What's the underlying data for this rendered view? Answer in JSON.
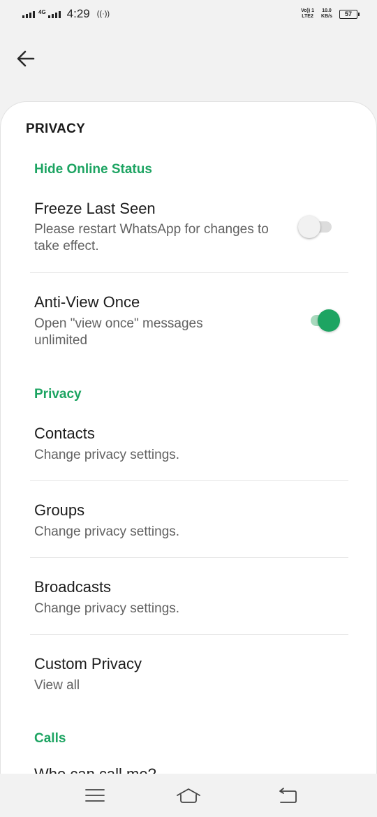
{
  "status_bar": {
    "network_small": "4G",
    "time": "4:29",
    "hotspot": "((·))",
    "volte": "Vo)) 1",
    "lte": "LTE2",
    "speed_value": "10.0",
    "speed_unit": "KB/s",
    "battery": "57"
  },
  "header": {
    "back_icon": "arrow-left-icon"
  },
  "page": {
    "title": "PRIVACY"
  },
  "sections": {
    "hide_online": {
      "header": "Hide Online Status",
      "freeze": {
        "title": "Freeze Last Seen",
        "subtitle": "Please restart WhatsApp for changes to take effect.",
        "enabled": false
      },
      "anti_view": {
        "title": "Anti-View Once",
        "subtitle": "Open \"view once\" messages unlimited",
        "enabled": true
      }
    },
    "privacy": {
      "header": "Privacy",
      "contacts": {
        "title": "Contacts",
        "subtitle": "Change privacy settings."
      },
      "groups": {
        "title": "Groups",
        "subtitle": "Change privacy settings."
      },
      "broadcasts": {
        "title": "Broadcasts",
        "subtitle": "Change privacy settings."
      },
      "custom": {
        "title": "Custom Privacy",
        "subtitle": "View all"
      }
    },
    "calls": {
      "header": "Calls",
      "partial_item": "Who can call me?"
    }
  },
  "nav_bar": {
    "menu_icon": "menu-icon",
    "home_icon": "home-icon",
    "back_icon": "back-icon"
  },
  "colors": {
    "accent": "#1da462",
    "background": "#f2f2f2",
    "card": "#ffffff"
  }
}
